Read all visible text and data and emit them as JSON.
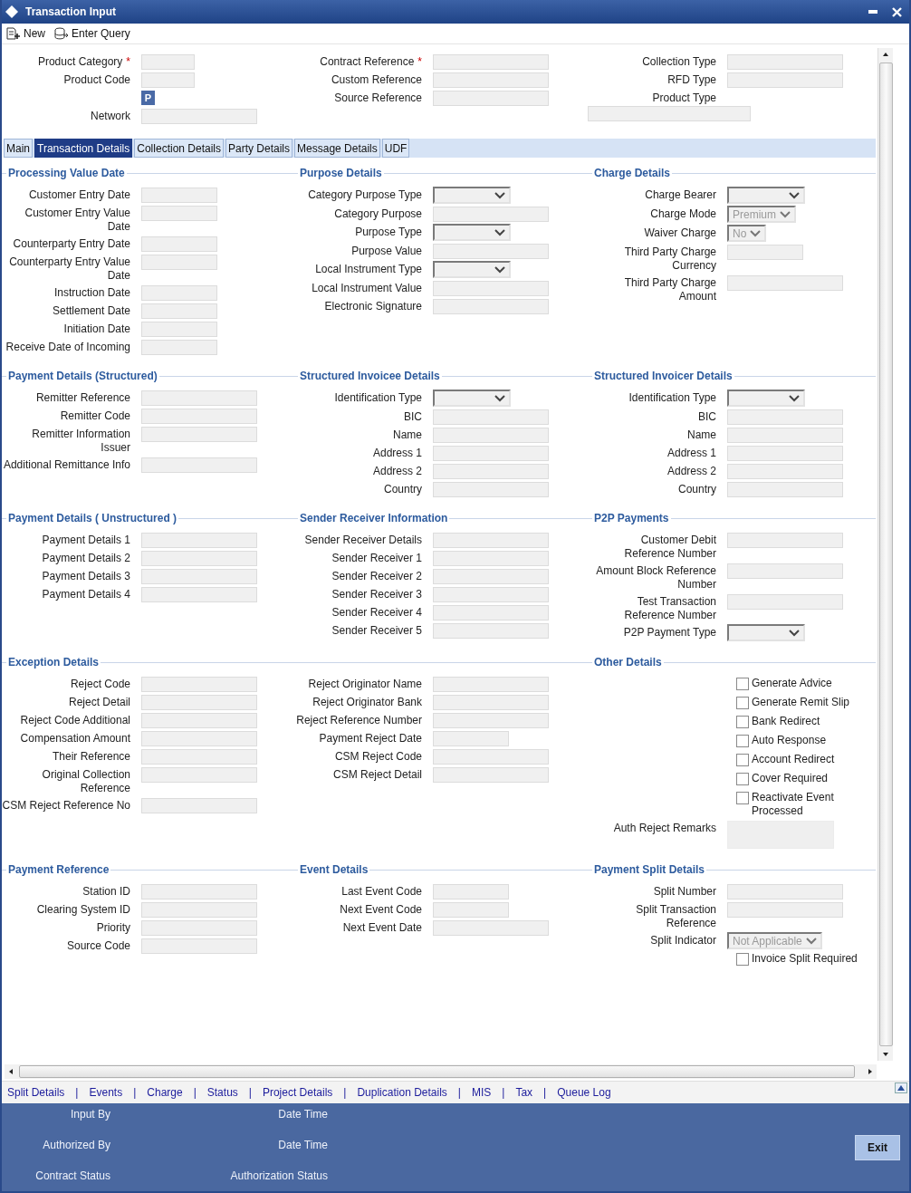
{
  "window": {
    "title": "Transaction Input"
  },
  "toolbar": [
    {
      "kind": "new",
      "label": "New"
    },
    {
      "kind": "query",
      "label": "Enter Query"
    }
  ],
  "header": [
    {
      "fields": [
        {
          "kind": "short",
          "label": "Product Category",
          "mark": "*"
        },
        {
          "kind": "short",
          "label": "Product Code"
        },
        {
          "kind": "button",
          "label": "P"
        },
        {
          "kind": "text",
          "label": "Network"
        }
      ]
    },
    {
      "fields": [
        {
          "kind": "text",
          "label": "Contract Reference",
          "mark": "*"
        },
        {
          "kind": "text",
          "label": "Custom Reference"
        },
        {
          "kind": "text",
          "label": "Source Reference"
        }
      ]
    },
    {
      "fields": [
        {
          "kind": "text",
          "label": "Collection Type"
        },
        {
          "kind": "text",
          "label": "RFD Type"
        },
        {
          "kind": "text_below",
          "label": "Product Type"
        }
      ]
    }
  ],
  "tabs": [
    {
      "label": "Main",
      "selected": false
    },
    {
      "label": "Transaction Details",
      "selected": true
    },
    {
      "label": "Collection Details",
      "selected": false
    },
    {
      "label": "Party Details",
      "selected": false
    },
    {
      "label": "Message Details",
      "selected": false
    },
    {
      "label": "UDF",
      "selected": false
    }
  ],
  "sections": [
    {
      "title": "Processing Value Date",
      "fields": [
        {
          "kind": "short",
          "label": "Customer Entry Date"
        },
        {
          "kind": "short",
          "label": "Customer Entry Value Date"
        },
        {
          "kind": "short",
          "label": "Counterparty Entry Date"
        },
        {
          "kind": "short",
          "label": "Counterparty Entry Value Date"
        },
        {
          "kind": "short",
          "label": "Instruction Date"
        },
        {
          "kind": "short",
          "label": "Settlement Date"
        },
        {
          "kind": "short",
          "label": "Initiation Date"
        },
        {
          "kind": "short",
          "label": "Receive Date of Incoming"
        }
      ]
    },
    {
      "title": "Purpose Details",
      "fields": [
        {
          "kind": "select",
          "label": "Category Purpose Type",
          "disabled": false
        },
        {
          "kind": "text",
          "label": "Category Purpose"
        },
        {
          "kind": "select",
          "label": "Purpose Type",
          "disabled": false
        },
        {
          "kind": "text",
          "label": "Purpose Value"
        },
        {
          "kind": "select",
          "label": "Local Instrument Type",
          "disabled": false
        },
        {
          "kind": "text",
          "label": "Local Instrument Value"
        },
        {
          "kind": "text",
          "label": "Electronic Signature"
        }
      ]
    },
    {
      "title": "Charge Details",
      "fields": [
        {
          "kind": "select",
          "label": "Charge Bearer",
          "disabled": false
        },
        {
          "kind": "select",
          "label": "Charge Mode",
          "value": "Premium",
          "disabled": true
        },
        {
          "kind": "select",
          "label": "Waiver Charge",
          "value": "No",
          "disabled": true
        },
        {
          "kind": "short",
          "label": "Third Party Charge Currency"
        },
        {
          "kind": "text",
          "label": "Third Party Charge Amount"
        }
      ]
    },
    {
      "title": "Payment Details (Structured)",
      "fields": [
        {
          "kind": "text",
          "label": "Remitter Reference"
        },
        {
          "kind": "text",
          "label": "Remitter Code"
        },
        {
          "kind": "text",
          "label": "Remitter Information Issuer"
        },
        {
          "kind": "text",
          "label": "Additional Remittance Info"
        }
      ]
    },
    {
      "title": "Structured Invoicee Details",
      "fields": [
        {
          "kind": "select",
          "label": "Identification Type",
          "disabled": false
        },
        {
          "kind": "text",
          "label": "BIC"
        },
        {
          "kind": "text",
          "label": "Name"
        },
        {
          "kind": "text",
          "label": "Address 1"
        },
        {
          "kind": "text",
          "label": "Address 2"
        },
        {
          "kind": "text",
          "label": "Country"
        }
      ]
    },
    {
      "title": "Structured Invoicer Details",
      "fields": [
        {
          "kind": "select",
          "label": "Identification Type",
          "disabled": false
        },
        {
          "kind": "text",
          "label": "BIC"
        },
        {
          "kind": "text",
          "label": "Name"
        },
        {
          "kind": "text",
          "label": "Address 1"
        },
        {
          "kind": "text",
          "label": "Address 2"
        },
        {
          "kind": "text",
          "label": "Country"
        }
      ]
    },
    {
      "title": "Payment Details ( Unstructured )",
      "fields": [
        {
          "kind": "text",
          "label": "Payment Details 1"
        },
        {
          "kind": "text",
          "label": "Payment Details 2"
        },
        {
          "kind": "text",
          "label": "Payment Details 3"
        },
        {
          "kind": "text",
          "label": "Payment Details 4"
        }
      ]
    },
    {
      "title": "Sender Receiver Information",
      "fields": [
        {
          "kind": "text",
          "label": "Sender Receiver Details"
        },
        {
          "kind": "text",
          "label": "Sender Receiver 1"
        },
        {
          "kind": "text",
          "label": "Sender Receiver 2"
        },
        {
          "kind": "text",
          "label": "Sender Receiver 3"
        },
        {
          "kind": "text",
          "label": "Sender Receiver 4"
        },
        {
          "kind": "text",
          "label": "Sender Receiver 5"
        }
      ]
    },
    {
      "title": "P2P Payments",
      "fields": [
        {
          "kind": "text",
          "label": "Customer Debit Reference Number"
        },
        {
          "kind": "text",
          "label": "Amount Block Reference Number"
        },
        {
          "kind": "text",
          "label": "Test Transaction Reference Number"
        },
        {
          "kind": "select",
          "label": "P2P Payment Type",
          "disabled": false
        }
      ]
    },
    {
      "title": "Exception Details",
      "columns": [
        [
          {
            "kind": "text",
            "label": "Reject Code"
          },
          {
            "kind": "text",
            "label": "Reject Detail"
          },
          {
            "kind": "text",
            "label": "Reject Code Additional"
          },
          {
            "kind": "text",
            "label": "Compensation Amount"
          },
          {
            "kind": "text",
            "label": "Their Reference"
          },
          {
            "kind": "text",
            "label": "Original Collection Reference"
          },
          {
            "kind": "text",
            "label": "CSM Reject Reference No"
          }
        ],
        [
          {
            "kind": "text",
            "label": "Reject Originator Name"
          },
          {
            "kind": "text",
            "label": "Reject Originator Bank"
          },
          {
            "kind": "text",
            "label": "Reject Reference Number"
          },
          {
            "kind": "short",
            "label": "Payment Reject Date"
          },
          {
            "kind": "text",
            "label": "CSM Reject Code"
          },
          {
            "kind": "text",
            "label": "CSM Reject Detail"
          }
        ]
      ]
    },
    {
      "title": "Other Details",
      "fields": [
        {
          "kind": "check",
          "label": "Generate Advice",
          "checked": false
        },
        {
          "kind": "check",
          "label": "Generate Remit Slip",
          "checked": false
        },
        {
          "kind": "check",
          "label": "Bank Redirect",
          "checked": false
        },
        {
          "kind": "check",
          "label": "Auto Response",
          "checked": false
        },
        {
          "kind": "check",
          "label": "Account Redirect",
          "checked": false
        },
        {
          "kind": "check",
          "label": "Cover Required",
          "checked": false
        },
        {
          "kind": "check",
          "label": "Reactivate Event Processed",
          "checked": false
        },
        {
          "kind": "area",
          "label": "Auth Reject Remarks"
        }
      ]
    },
    {
      "title": "Payment Reference",
      "fields": [
        {
          "kind": "text",
          "label": "Station ID"
        },
        {
          "kind": "text",
          "label": "Clearing System ID"
        },
        {
          "kind": "text",
          "label": "Priority"
        },
        {
          "kind": "text",
          "label": "Source Code"
        }
      ]
    },
    {
      "title": "Event Details",
      "fields": [
        {
          "kind": "short",
          "label": "Last Event Code"
        },
        {
          "kind": "short",
          "label": "Next Event Code"
        },
        {
          "kind": "text",
          "label": "Next Event Date"
        }
      ]
    },
    {
      "title": "Payment Split Details",
      "fields": [
        {
          "kind": "text",
          "label": "Split Number"
        },
        {
          "kind": "text",
          "label": "Split Transaction Reference"
        },
        {
          "kind": "select",
          "label": "Split Indicator",
          "value": "Not Applicable",
          "disabled": true
        },
        {
          "kind": "check",
          "label": "Invoice Split Required",
          "checked": false
        }
      ]
    }
  ],
  "footer_links": {
    "separator": "|",
    "items": [
      "Split Details",
      "Events",
      "Charge",
      "Status",
      "Project Details",
      "Duplication Details",
      "MIS",
      "Tax",
      "Queue Log"
    ]
  },
  "audit": [
    [
      "Input By",
      "Date Time"
    ],
    [
      "Authorized By",
      "Date Time"
    ],
    [
      "Contract Status",
      "Authorization Status"
    ]
  ],
  "exit_button": "Exit"
}
